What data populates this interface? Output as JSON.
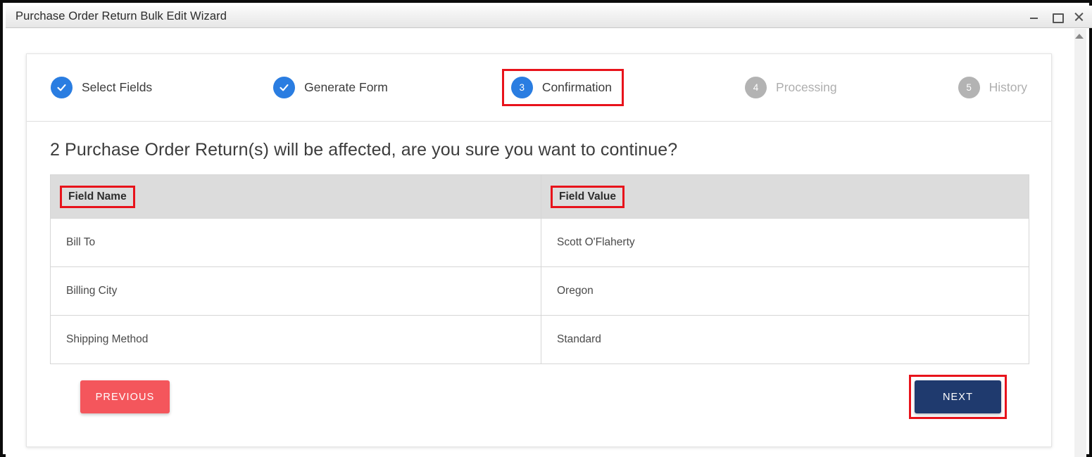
{
  "window": {
    "title": "Purchase Order Return Bulk Edit Wizard",
    "controls": {
      "minimize": "minimize-icon",
      "maximize": "maximize-icon",
      "close": "close-icon"
    }
  },
  "scrollbar": {
    "up_arrow": "scroll-up-arrow-icon"
  },
  "stepper": {
    "steps": [
      {
        "number": "1",
        "label": "Select Fields",
        "state": "done",
        "icon": "check-icon",
        "highlighted": false
      },
      {
        "number": "2",
        "label": "Generate Form",
        "state": "done",
        "icon": "check-icon",
        "highlighted": false
      },
      {
        "number": "3",
        "label": "Confirmation",
        "state": "active",
        "icon": "",
        "highlighted": true
      },
      {
        "number": "4",
        "label": "Processing",
        "state": "todo",
        "icon": "",
        "highlighted": false
      },
      {
        "number": "5",
        "label": "History",
        "state": "todo",
        "icon": "",
        "highlighted": false
      }
    ]
  },
  "main": {
    "headline": "2 Purchase Order Return(s) will be affected, are you sure you want to continue?",
    "table": {
      "headers": [
        {
          "label": "Field Name",
          "highlighted": true
        },
        {
          "label": "Field Value",
          "highlighted": true
        }
      ],
      "rows": [
        {
          "field_name": "Bill To",
          "field_value": "Scott O'Flaherty"
        },
        {
          "field_name": "Billing City",
          "field_value": "Oregon"
        },
        {
          "field_name": "Shipping Method",
          "field_value": "Standard"
        }
      ]
    }
  },
  "footer": {
    "previous_label": "PREVIOUS",
    "next_label": "NEXT",
    "next_highlighted": true
  },
  "colors": {
    "accent_blue": "#2a7de1",
    "inactive_gray": "#b3b3b3",
    "previous_red": "#f4565c",
    "next_navy": "#1f3a6e",
    "annotation_red": "#e8131b",
    "table_header_bg": "#dcdcdc"
  }
}
